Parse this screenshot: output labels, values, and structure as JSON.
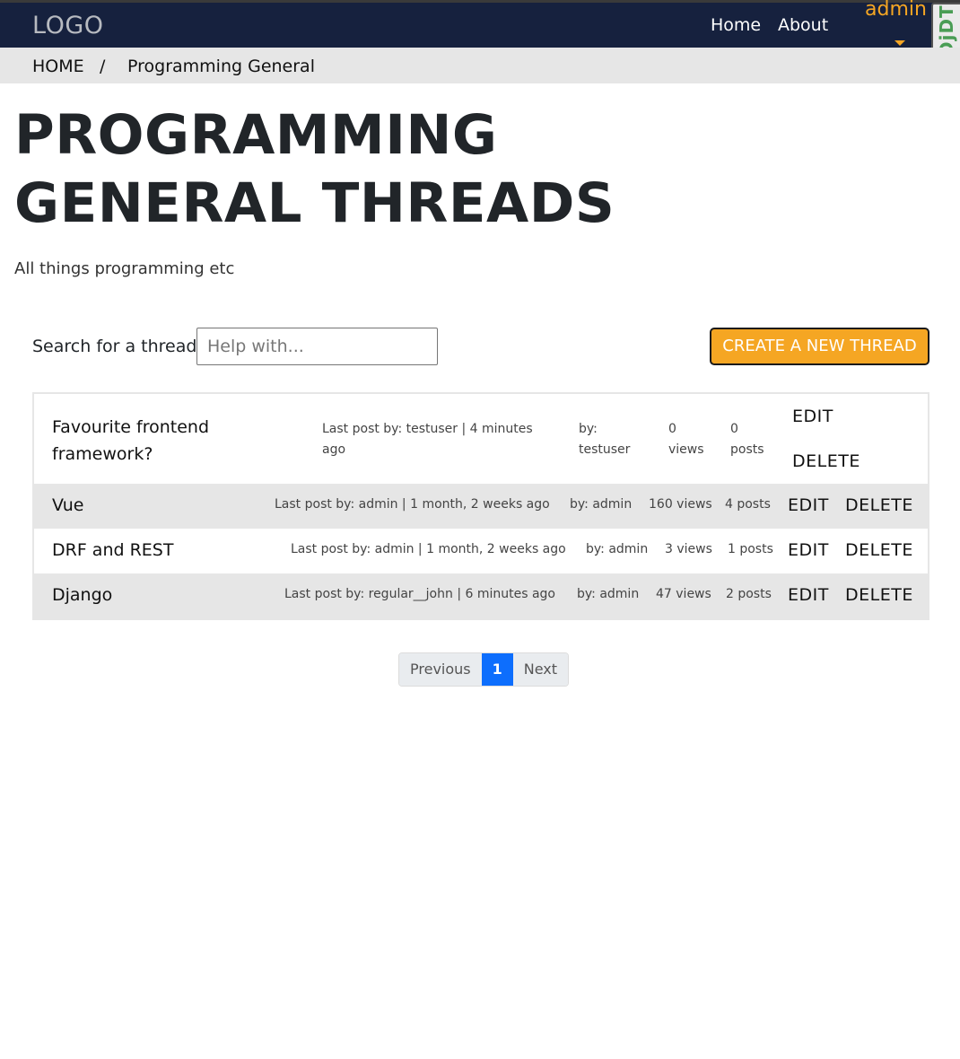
{
  "navbar": {
    "logo": "LOGO",
    "links": [
      "Home",
      "About"
    ],
    "user": "admin",
    "toolbar_label": "DjDT"
  },
  "breadcrumb": {
    "home": "HOME",
    "separator": "/",
    "current": "Programming General"
  },
  "header": {
    "title": "PROGRAMMING GENERAL THREADS",
    "subtitle": "All things programming etc"
  },
  "search": {
    "label": "Search for a thread:",
    "placeholder": "Help with...",
    "value": ""
  },
  "create_button": "CREATE A NEW THREAD",
  "threads": [
    {
      "title": "Favourite frontend framework?",
      "last_post": "Last post by: testuser | 4 minutes ago",
      "author": "by: testuser",
      "views": "0 views",
      "posts": "0 posts",
      "edit": "EDIT",
      "delete": "DELETE"
    },
    {
      "title": "Vue",
      "last_post": "Last post by: admin | 1 month, 2 weeks ago",
      "author": "by: admin",
      "views": "160 views",
      "posts": "4 posts",
      "edit": "EDIT",
      "delete": "DELETE"
    },
    {
      "title": "DRF and REST",
      "last_post": "Last post by: admin | 1 month, 2 weeks ago",
      "author": "by: admin",
      "views": "3 views",
      "posts": "1 posts",
      "edit": "EDIT",
      "delete": "DELETE"
    },
    {
      "title": "Django",
      "last_post": "Last post by: regular__john | 6 minutes ago",
      "author": "by: admin",
      "views": "47 views",
      "posts": "2 posts",
      "edit": "EDIT",
      "delete": "DELETE"
    }
  ],
  "pagination": {
    "previous": "Previous",
    "current": "1",
    "next": "Next"
  },
  "colors": {
    "navbar": "#16213e",
    "accent": "#f5a623",
    "page_active": "#0d6efd"
  }
}
